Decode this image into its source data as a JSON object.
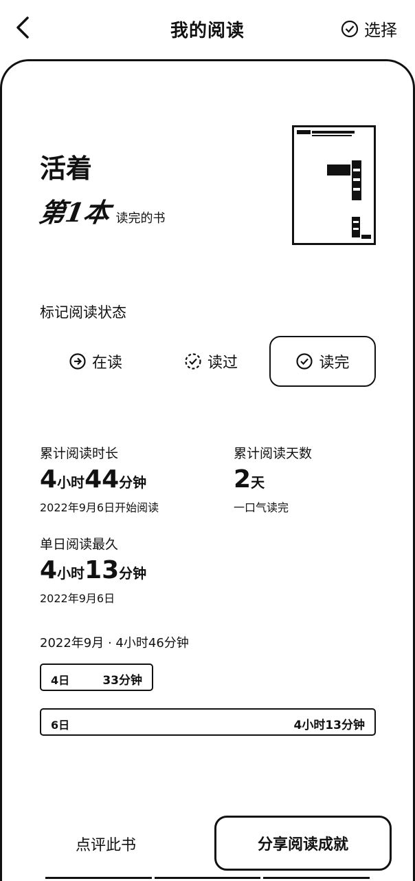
{
  "header": {
    "title": "我的阅读",
    "select_label": "选择"
  },
  "book": {
    "title": "活着",
    "nth_label": "第1本",
    "nth_suffix": "读完的书"
  },
  "status": {
    "heading": "标记阅读状态",
    "options": [
      {
        "label": "在读",
        "icon": "arrow-right-circle-icon",
        "active": false
      },
      {
        "label": "读过",
        "icon": "dashed-check-circle-icon",
        "active": false
      },
      {
        "label": "读完",
        "icon": "check-circle-icon",
        "active": true
      }
    ]
  },
  "stats": {
    "total_time": {
      "label": "累计阅读时长",
      "h": "4",
      "h_unit": "小时",
      "m": "44",
      "m_unit": "分钟",
      "sub": "2022年9月6日开始阅读"
    },
    "total_days": {
      "label": "累计阅读天数",
      "days": "2",
      "days_unit": "天",
      "sub": "一口气读完"
    },
    "longest_day": {
      "label": "单日阅读最久",
      "h": "4",
      "h_unit": "小时",
      "m": "13",
      "m_unit": "分钟",
      "sub": "2022年9月6日"
    }
  },
  "month": {
    "summary": "2022年9月 · 4小时46分钟",
    "days": [
      {
        "label": "4日",
        "value": "33分钟",
        "fraction": 0.13
      },
      {
        "label": "6日",
        "value": "4小时13分钟",
        "fraction": 1.0
      }
    ]
  },
  "footer": {
    "review_label": "点评此书",
    "share_label": "分享阅读成就"
  }
}
